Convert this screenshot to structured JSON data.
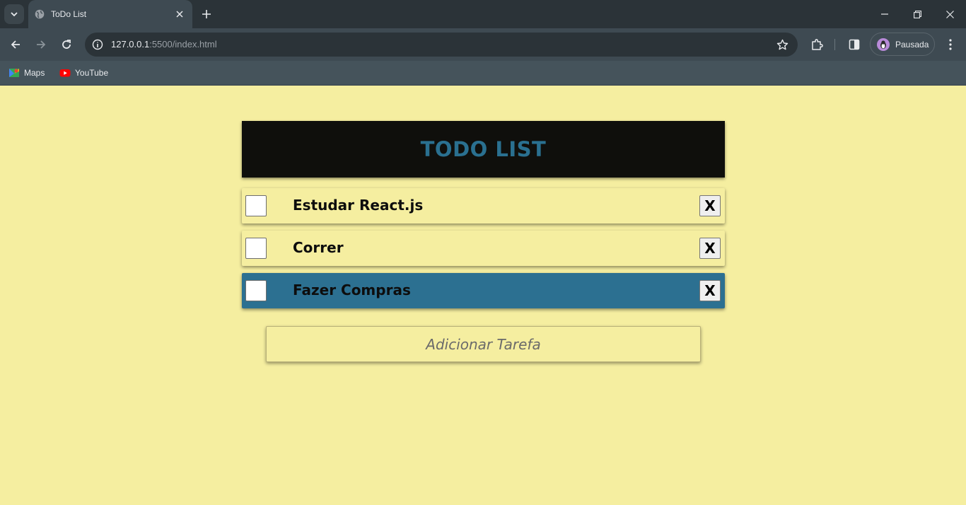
{
  "browser": {
    "tab": {
      "title": "ToDo List"
    },
    "url": {
      "host": "127.0.0.1",
      "rest": ":5500/index.html"
    },
    "profile": {
      "label": "Pausada"
    },
    "bookmarks": [
      {
        "label": "Maps",
        "icon": "maps-icon"
      },
      {
        "label": "YouTube",
        "icon": "youtube-icon"
      }
    ]
  },
  "app": {
    "title": "TODO LIST",
    "tasks": [
      {
        "label": "Estudar React.js",
        "checked": false,
        "highlighted": false,
        "delete_label": "X"
      },
      {
        "label": "Correr",
        "checked": false,
        "highlighted": false,
        "delete_label": "X"
      },
      {
        "label": "Fazer Compras",
        "checked": false,
        "highlighted": true,
        "delete_label": "X"
      }
    ],
    "add_input": {
      "placeholder": "Adicionar Tarefa",
      "value": ""
    }
  },
  "colors": {
    "background": "#f5eea0",
    "header_bg": "#0f0f0c",
    "title": "#2a7090",
    "highlight": "#2c7091"
  }
}
